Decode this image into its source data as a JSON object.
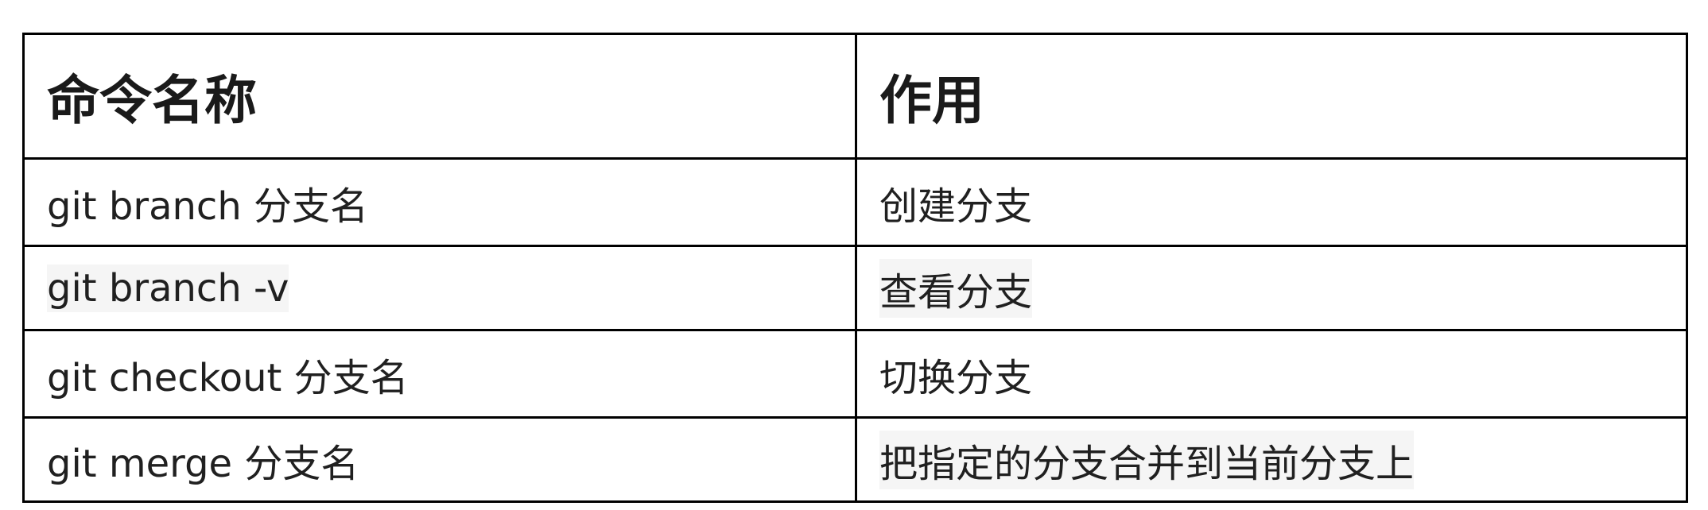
{
  "table": {
    "headers": [
      "命令名称",
      "作用"
    ],
    "rows": [
      {
        "command": "git branch  分支名",
        "purpose": "创建分支",
        "command_highlight": false,
        "purpose_highlight": false
      },
      {
        "command": "git branch -v",
        "purpose": "查看分支",
        "command_highlight": true,
        "purpose_highlight": true
      },
      {
        "command": "git checkout  分支名",
        "purpose": "切换分支",
        "command_highlight": false,
        "purpose_highlight": false
      },
      {
        "command": "git merge  分支名",
        "purpose": "把指定的分支合并到当前分支上",
        "command_highlight": false,
        "purpose_highlight": true
      }
    ]
  },
  "colors": {
    "border": "#000000",
    "highlight": "#f5f5f5",
    "text": "#202020"
  }
}
